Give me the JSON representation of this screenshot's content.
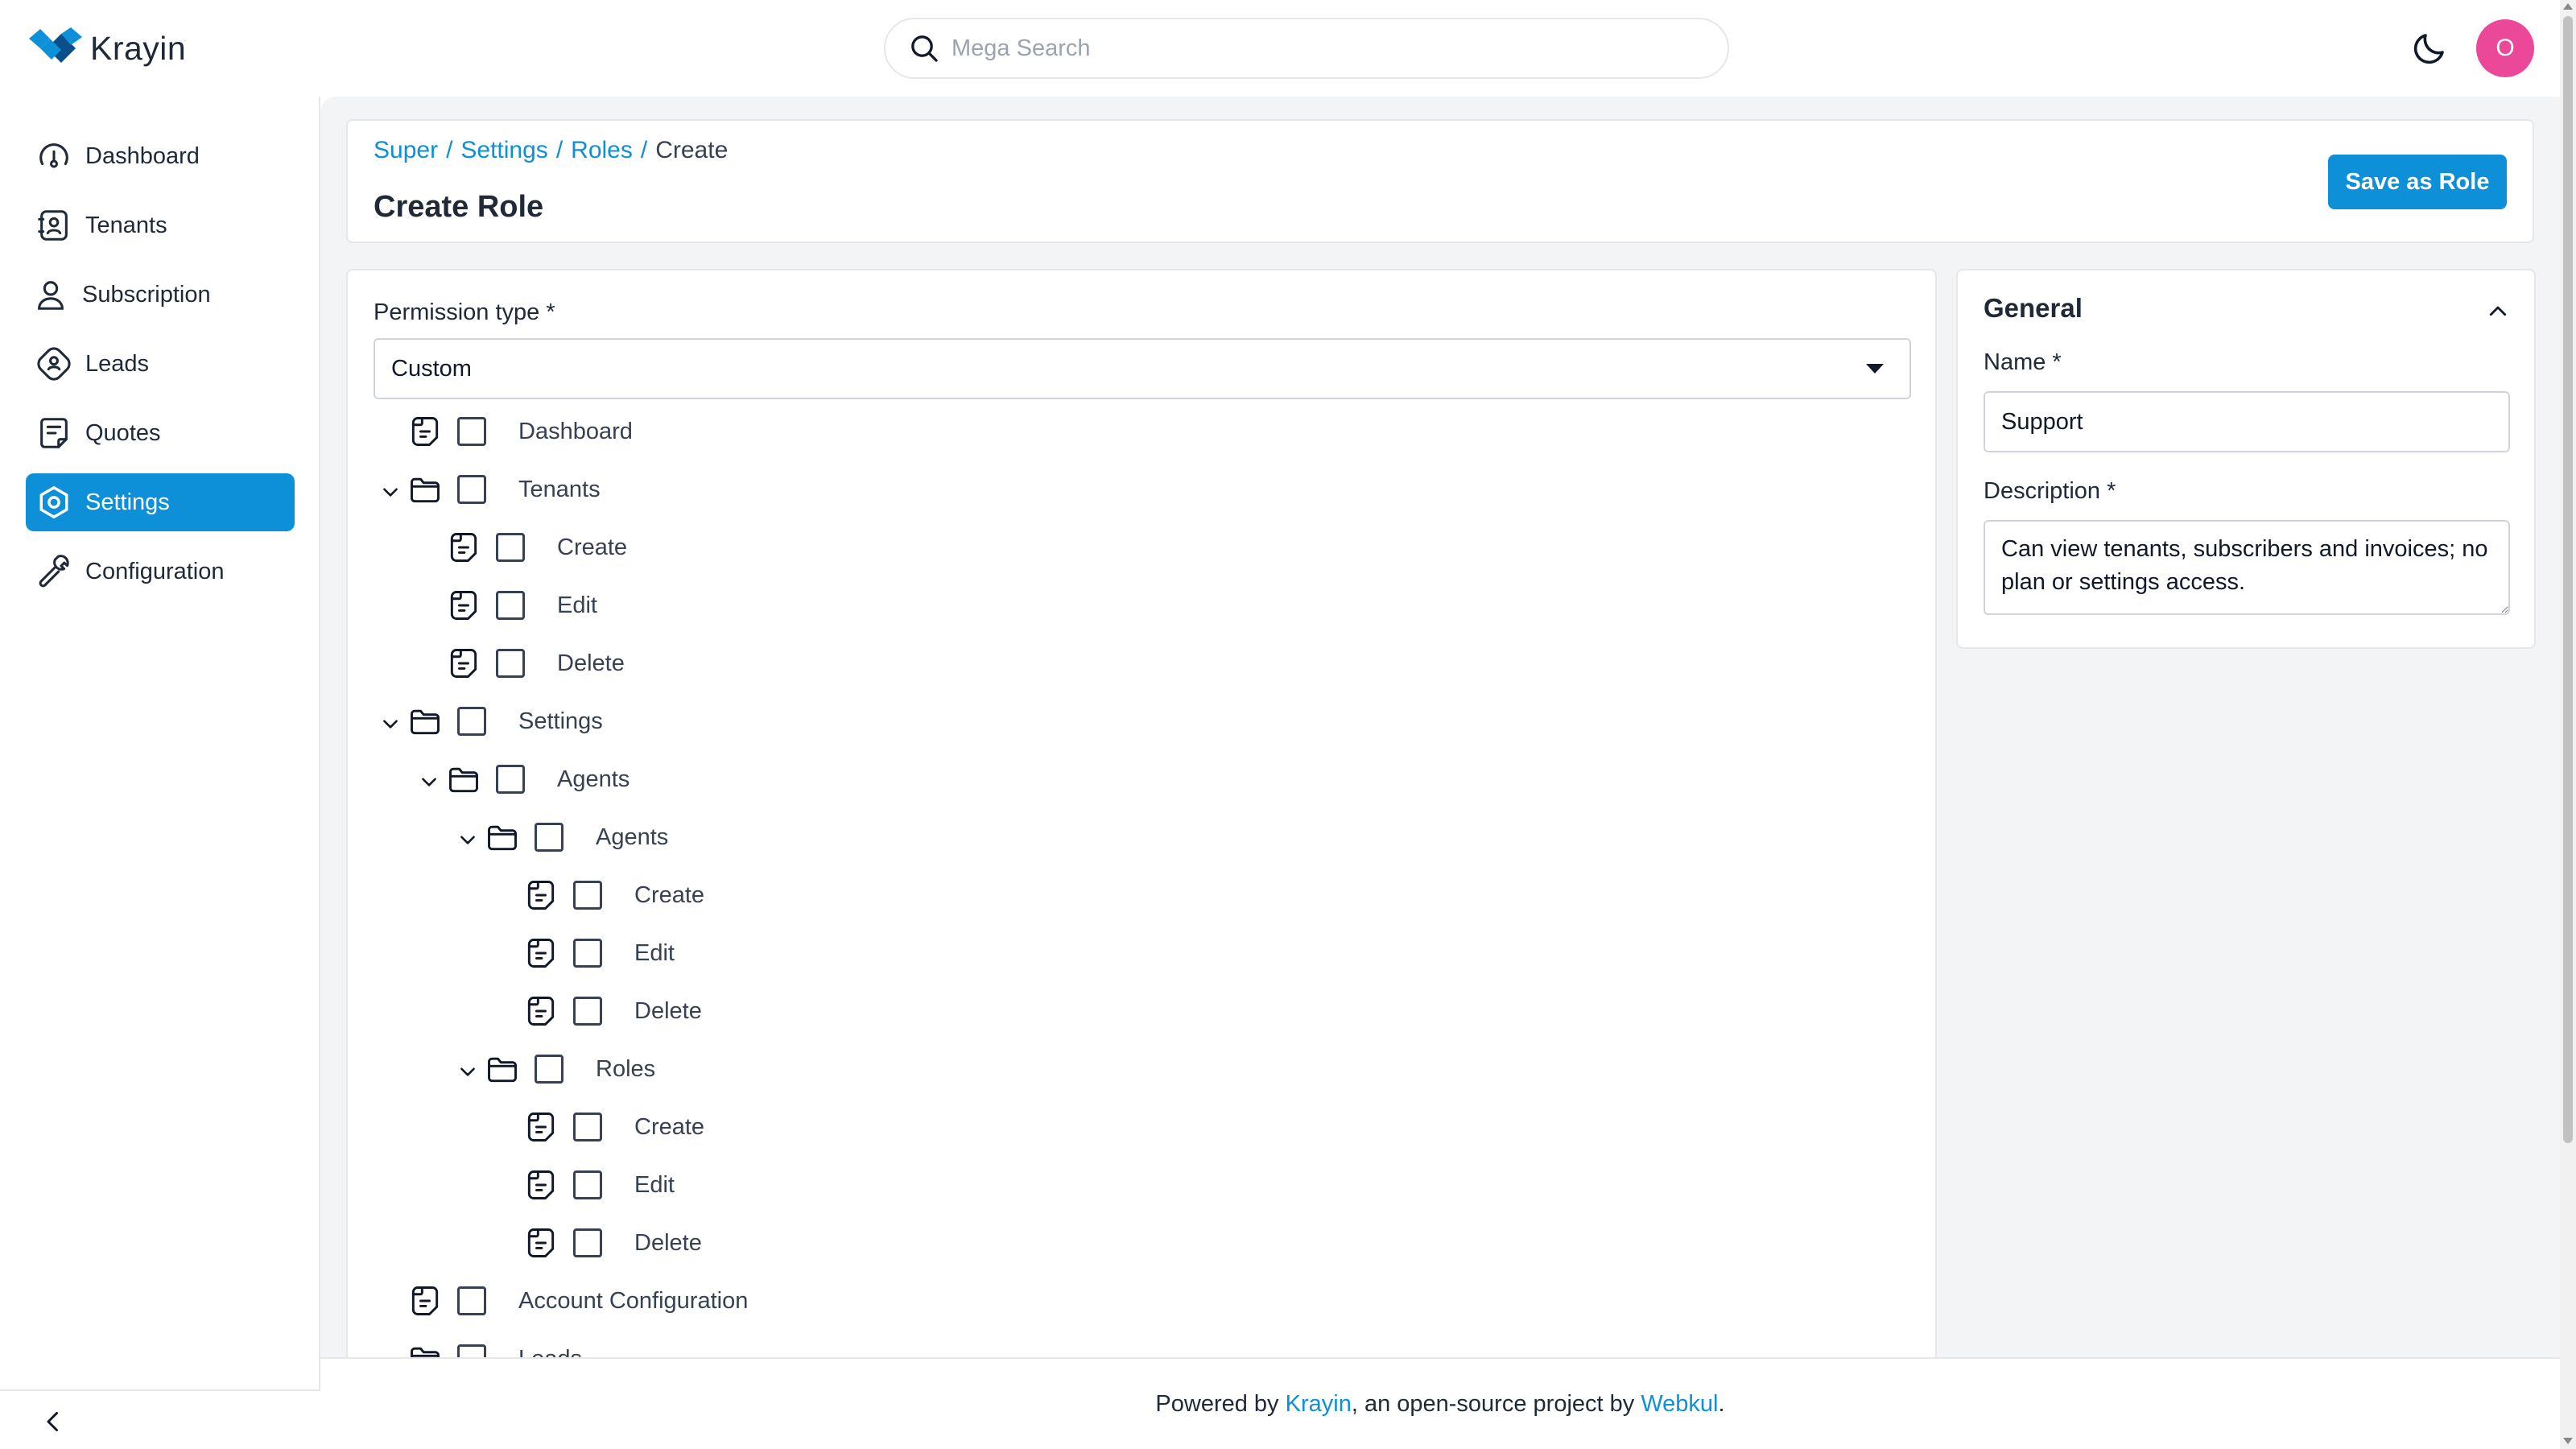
{
  "app": {
    "name": "Krayin"
  },
  "header": {
    "search_placeholder": "Mega Search",
    "avatar_initial": "O"
  },
  "sidebar": {
    "items": [
      {
        "label": "Dashboard",
        "icon": "dashboard-icon",
        "active": false
      },
      {
        "label": "Tenants",
        "icon": "tenants-icon",
        "active": false
      },
      {
        "label": "Subscription",
        "icon": "subscription-icon",
        "active": false
      },
      {
        "label": "Leads",
        "icon": "leads-icon",
        "active": false
      },
      {
        "label": "Quotes",
        "icon": "quotes-icon",
        "active": false
      },
      {
        "label": "Settings",
        "icon": "settings-icon",
        "active": true
      },
      {
        "label": "Configuration",
        "icon": "configuration-icon",
        "active": false
      }
    ]
  },
  "breadcrumb": {
    "items": [
      "Super",
      "Settings",
      "Roles"
    ],
    "sep": "/",
    "current": "Create"
  },
  "page": {
    "title": "Create Role",
    "save_label": "Save as Role"
  },
  "permissions": {
    "type_label": "Permission type *",
    "type_value": "Custom",
    "tree": [
      {
        "label": "Dashboard",
        "kind": "file"
      },
      {
        "label": "Tenants",
        "kind": "folder"
      },
      {
        "label": "Create",
        "kind": "file"
      },
      {
        "label": "Edit",
        "kind": "file"
      },
      {
        "label": "Delete",
        "kind": "file"
      },
      {
        "label": "Settings",
        "kind": "folder"
      },
      {
        "label": "Agents",
        "kind": "folder"
      },
      {
        "label": "Agents",
        "kind": "folder"
      },
      {
        "label": "Create",
        "kind": "file"
      },
      {
        "label": "Edit",
        "kind": "file"
      },
      {
        "label": "Delete",
        "kind": "file"
      },
      {
        "label": "Roles",
        "kind": "folder"
      },
      {
        "label": "Create",
        "kind": "file"
      },
      {
        "label": "Edit",
        "kind": "file"
      },
      {
        "label": "Delete",
        "kind": "file"
      },
      {
        "label": "Account Configuration",
        "kind": "file"
      },
      {
        "label": "Leads",
        "kind": "folder"
      }
    ]
  },
  "general": {
    "title": "General",
    "name_label": "Name *",
    "name_value": "Support",
    "description_label": "Description *",
    "description_value": "Can view tenants, subscribers and invoices; no plan or settings access."
  },
  "footer": {
    "prefix": "Powered by",
    "krayin_link": "Krayin",
    "middle": ", an open-source project by",
    "webkul_link": "Webkul",
    "suffix": "."
  },
  "colors": {
    "brand": "#0e90d9",
    "avatar": "#ec4899"
  }
}
